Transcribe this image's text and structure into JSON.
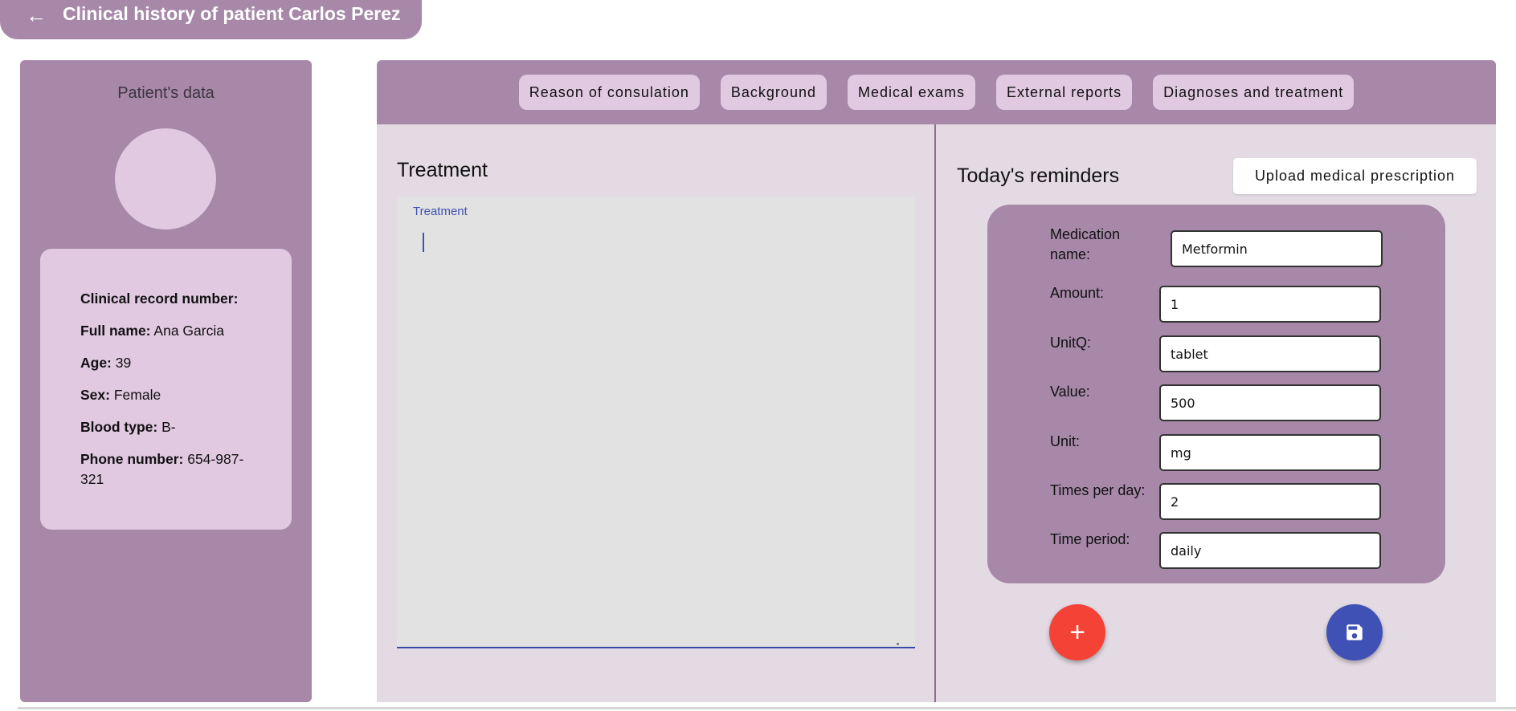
{
  "header": {
    "back_icon": "arrow-left-icon",
    "title": "Clinical history of patient Carlos Perez"
  },
  "patient": {
    "section_title": "Patient's data",
    "fields": [
      {
        "label": "Clinical record number:",
        "value": ""
      },
      {
        "label": "Full name:",
        "value": "Ana Garcia"
      },
      {
        "label": "Age:",
        "value": "39"
      },
      {
        "label": "Sex:",
        "value": "Female"
      },
      {
        "label": "Blood type:",
        "value": "B-"
      },
      {
        "label": "Phone number:",
        "value": "654-987-321"
      }
    ]
  },
  "tabs": [
    "Reason of consulation",
    "Background",
    "Medical exams",
    "External reports",
    "Diagnoses and treatment"
  ],
  "treatment": {
    "title": "Treatment",
    "field_label": "Treatment",
    "value": ""
  },
  "reminders": {
    "title": "Today's reminders",
    "upload_label": "Upload medical prescription",
    "fields": [
      {
        "label": "Medication name:",
        "value": "Metformin"
      },
      {
        "label": "Amount:",
        "value": "1"
      },
      {
        "label": "UnitQ:",
        "value": "tablet"
      },
      {
        "label": "Value:",
        "value": "500"
      },
      {
        "label": "Unit:",
        "value": "mg"
      },
      {
        "label": "Times per day:",
        "value": "2"
      },
      {
        "label": "Time period:",
        "value": "daily"
      }
    ],
    "add_label": "+",
    "save_icon": "save-icon"
  },
  "colors": {
    "primary": "#a788a9",
    "light": "#e1c9e1",
    "panel": "#e4dae4",
    "fab_add": "#f44336",
    "fab_save": "#3f51b5"
  }
}
